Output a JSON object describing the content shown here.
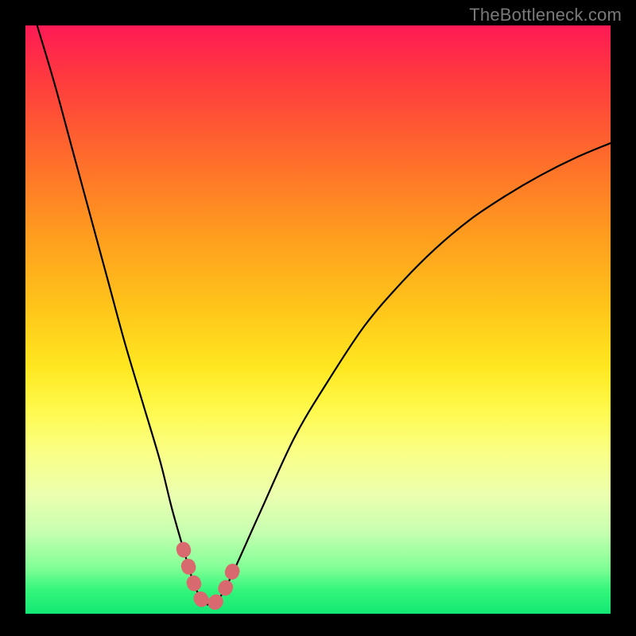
{
  "watermark": "TheBottleneck.com",
  "chart_data": {
    "type": "line",
    "title": "",
    "xlabel": "",
    "ylabel": "",
    "xlim": [
      0,
      100
    ],
    "ylim": [
      0,
      100
    ],
    "series": [
      {
        "name": "bottleneck-curve",
        "color": "#000000",
        "x": [
          2,
          5,
          8,
          11,
          14,
          17,
          20,
          23,
          25,
          27,
          28.5,
          30,
          31.5,
          33,
          35,
          40,
          46,
          52,
          58,
          64,
          70,
          76,
          82,
          88,
          94,
          100
        ],
        "y": [
          100,
          90,
          79,
          68,
          57,
          46,
          36,
          26,
          18,
          11,
          6,
          2.5,
          1.5,
          2.5,
          6,
          17,
          30,
          40,
          49,
          56,
          62,
          67,
          71,
          74.5,
          77.5,
          80
        ]
      },
      {
        "name": "highlight-bottom",
        "color": "#d86a6f",
        "x": [
          27,
          28.5,
          30,
          31.5,
          33,
          34.5,
          36
        ],
        "y": [
          11,
          6,
          2.5,
          1.5,
          2.5,
          5,
          9
        ]
      }
    ]
  }
}
